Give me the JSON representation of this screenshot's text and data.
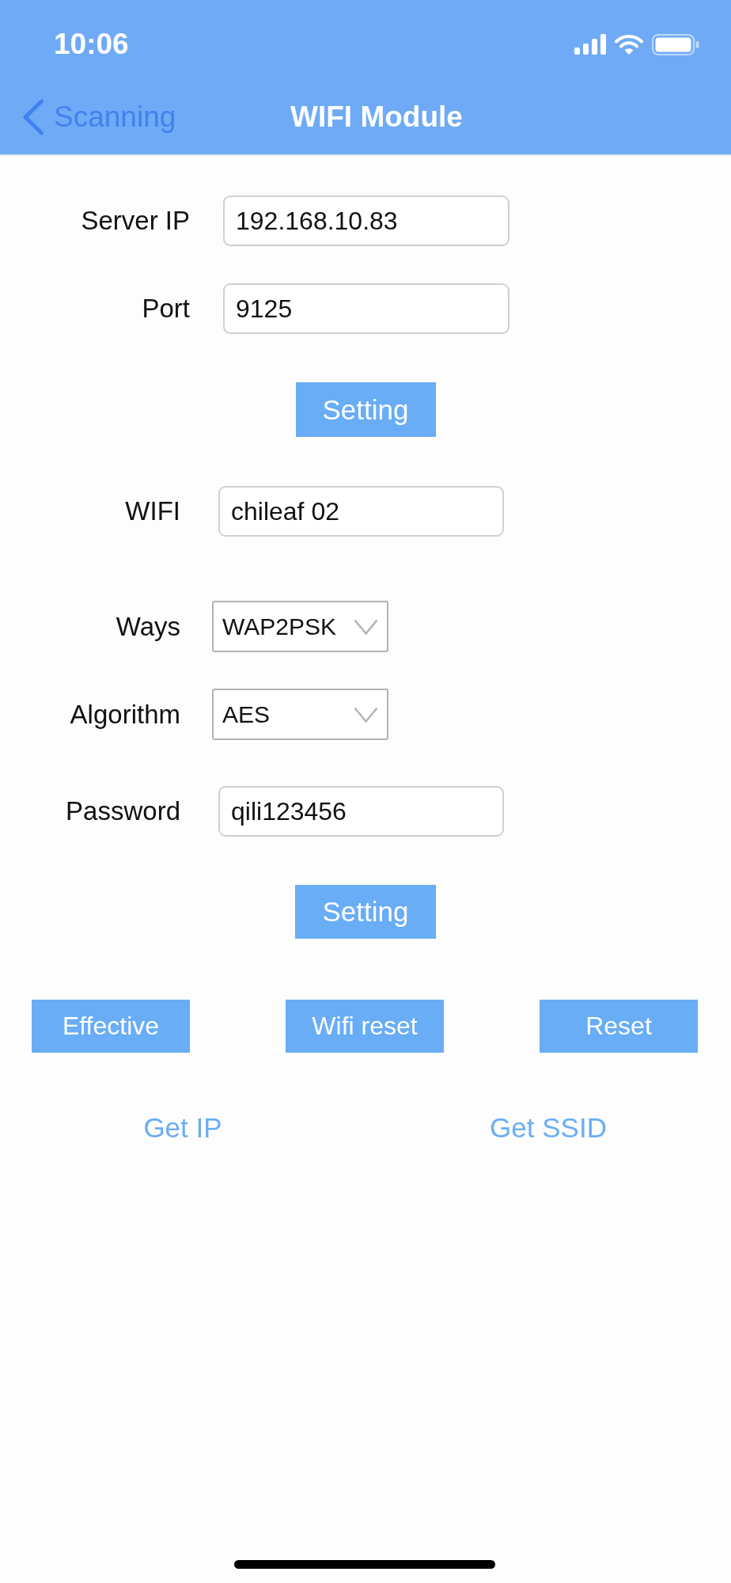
{
  "status_bar": {
    "time": "10:06"
  },
  "nav_bar": {
    "back": "Scanning",
    "title": "WIFI Module"
  },
  "server": {
    "fields": [
      {
        "kind": "text",
        "label": "Server IP",
        "value": "192.168.10.83"
      },
      {
        "kind": "text",
        "label": "Port",
        "value": "9125"
      }
    ],
    "button": "Setting"
  },
  "wifi": {
    "fields": [
      {
        "kind": "text",
        "label": "WIFI",
        "value": "chileaf 02"
      },
      {
        "kind": "select",
        "label": "Ways",
        "value": "WAP2PSK"
      },
      {
        "kind": "select",
        "label": "Algorithm",
        "value": "AES"
      },
      {
        "kind": "text",
        "label": "Password",
        "value": "qili123456"
      }
    ],
    "button": "Setting"
  },
  "actions": [
    "Effective",
    "Wifi reset",
    "Reset"
  ],
  "links": [
    "Get IP",
    "Get SSID"
  ]
}
